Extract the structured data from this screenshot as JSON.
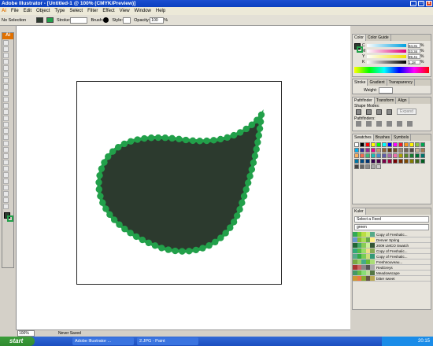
{
  "window": {
    "title": "Adobe Illustrator - [Untitled-1 @ 100% (CMYK/Preview)]"
  },
  "menu": [
    "File",
    "Edit",
    "Object",
    "Type",
    "Select",
    "Filter",
    "Effect",
    "View",
    "Window",
    "Help"
  ],
  "control": {
    "selection": "No Selection",
    "stroke_label": "Stroke:",
    "brush_label": "Brush:",
    "style_label": "Style:",
    "opacity_label": "Opacity:",
    "opacity_value": "100",
    "opacity_unit": "%"
  },
  "colors": {
    "fill": "#2c3a2e",
    "stroke": "#22a04a",
    "accent": "#1b4fd0"
  },
  "panels": {
    "color": {
      "tabs": [
        "Color",
        "Color Guide"
      ],
      "rows": [
        {
          "label": "C",
          "value": "84,31"
        },
        {
          "label": "M",
          "value": "33,34"
        },
        {
          "label": "Y",
          "value": "89,41"
        },
        {
          "label": "K",
          "value": "1,18"
        }
      ],
      "unit": "%"
    },
    "stroke": {
      "tabs": [
        "Stroke",
        "Gradient",
        "Transparency"
      ],
      "weight_label": "Weight:"
    },
    "pathfinder": {
      "tabs": [
        "Pathfinder",
        "Transform",
        "Align"
      ],
      "shape_modes": "Shape Modes:",
      "pathfinders": "Pathfinders:",
      "expand": "Expand"
    },
    "swatches": {
      "tabs": [
        "Swatches",
        "Brushes",
        "Symbols"
      ]
    },
    "kuler": {
      "tabs": [
        "Kuler"
      ],
      "select_feed": "Select a Feed",
      "search_value": "green",
      "themes": [
        "Copy of Freshalic...",
        "Denver Spring",
        "2009 LMCO Swatch",
        "Copy of Freshalic...",
        "Copy of Freshalic...",
        "Freshnouveau...",
        "RedGreys",
        "Meadowscape",
        "bitter sweet"
      ]
    }
  },
  "status": {
    "zoom": "100%",
    "saved": "Never Saved"
  },
  "taskbar": {
    "start": "start",
    "tasks": [
      "Adobe Illustrator ...",
      "2.JPG - Paint"
    ],
    "time": "20:15"
  }
}
